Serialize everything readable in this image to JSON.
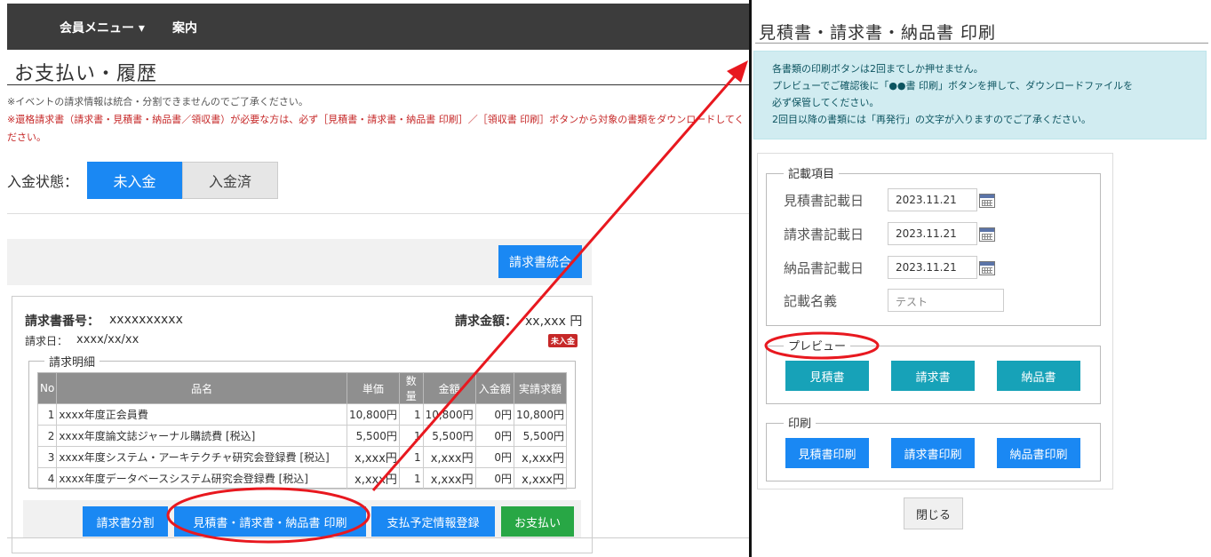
{
  "left": {
    "nav": {
      "menu": "会員メニュー ▾",
      "guide": "案内"
    },
    "page_title": "お支払い・履歴",
    "notes": {
      "note1": "※イベントの請求情報は統合・分割できませんのでご了承ください。",
      "note2": "※還格請求書（請求書・見積書・納品書／領収書）が必要な方は、必ず［見積書・請求書・納品書 印刷］／［領収書 印刷］ボタンから対象の書類をダウンロードしてください。"
    },
    "status": {
      "label": "入金状態：",
      "unpaid": "未入金",
      "paid": "入金済"
    },
    "merge_button": "請求書統合",
    "invoice": {
      "number_label": "請求書番号：",
      "number_value": "xxxxxxxxxx",
      "amount_label": "請求金額：",
      "amount_value": "xx,xxx 円",
      "date_label": "請求日：",
      "date_value": "xxxx/xx/xx",
      "badge": "未入金",
      "detail_legend": "請求明細",
      "columns": [
        "No",
        "品名",
        "単価",
        "数量",
        "金額",
        "入金額",
        "実請求額"
      ],
      "rows": [
        {
          "no": "1",
          "name": "xxxx年度正会員費",
          "price": "10,800円",
          "qty": "1",
          "amount": "10,800円",
          "paid": "0円",
          "billed": "10,800円"
        },
        {
          "no": "2",
          "name": "xxxx年度論文誌ジャーナル購読費 [税込]",
          "price": "5,500円",
          "qty": "1",
          "amount": "5,500円",
          "paid": "0円",
          "billed": "5,500円"
        },
        {
          "no": "3",
          "name": "xxxx年度システム・アーキテクチャ研究会登録費 [税込]",
          "price": "x,xxx円",
          "qty": "1",
          "amount": "x,xxx円",
          "paid": "0円",
          "billed": "x,xxx円"
        },
        {
          "no": "4",
          "name": "xxxx年度データベースシステム研究会登録費 [税込]",
          "price": "x,xxx円",
          "qty": "1",
          "amount": "x,xxx円",
          "paid": "0円",
          "billed": "x,xxx円"
        }
      ]
    },
    "actions": {
      "split": "請求書分割",
      "print_docs": "見積書・請求書・納品書 印刷",
      "schedule": "支払予定情報登録",
      "pay": "お支払い"
    }
  },
  "right": {
    "title": "見積書・請求書・納品書 印刷",
    "alert": {
      "line1": "各書類の印刷ボタンは2回までしか押せません。",
      "line2": "プレビューでご確認後に「●●書 印刷」ボタンを押して、ダウンロードファイルを",
      "line3": "必ず保管してください。",
      "line4": "2回目以降の書類には「再発行」の文字が入りますのでご了承ください。"
    },
    "entry": {
      "legend": "記載項目",
      "estimate_date_label": "見積書記載日",
      "estimate_date": "2023.11.21",
      "invoice_date_label": "請求書記載日",
      "invoice_date": "2023.11.21",
      "delivery_date_label": "納品書記載日",
      "delivery_date": "2023.11.21",
      "name_label": "記載名義",
      "name_value": "テスト"
    },
    "preview": {
      "legend": "プレビュー",
      "estimate": "見積書",
      "invoice": "請求書",
      "delivery": "納品書"
    },
    "print": {
      "legend": "印刷",
      "estimate": "見積書印刷",
      "invoice": "請求書印刷",
      "delivery": "納品書印刷"
    },
    "close": "閉じる"
  },
  "annotation": {
    "color": "#e8181f"
  }
}
